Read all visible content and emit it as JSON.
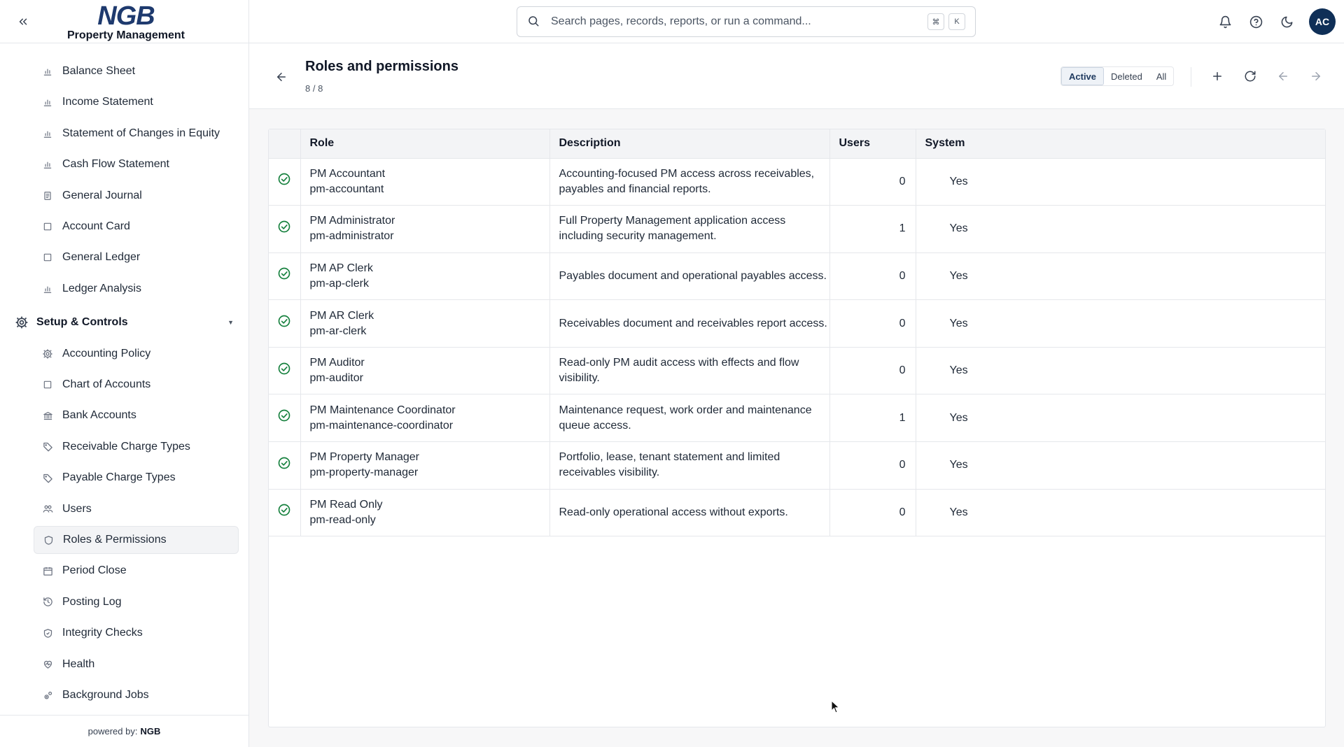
{
  "brand": {
    "logo": "NGB",
    "name": "Property Management"
  },
  "sidebar": {
    "items_top": [
      {
        "label": "Balance Sheet",
        "icon": "bar-chart-icon"
      },
      {
        "label": "Income Statement",
        "icon": "bar-chart-icon"
      },
      {
        "label": "Statement of Changes in Equity",
        "icon": "bar-chart-icon"
      },
      {
        "label": "Cash Flow Statement",
        "icon": "bar-chart-icon"
      },
      {
        "label": "General Journal",
        "icon": "document-icon"
      },
      {
        "label": "Account Card",
        "icon": "square-icon"
      },
      {
        "label": "General Ledger",
        "icon": "square-icon"
      },
      {
        "label": "Ledger Analysis",
        "icon": "bar-chart-icon"
      }
    ],
    "section": {
      "label": "Setup & Controls",
      "icon": "gear-icon"
    },
    "items_setup": [
      {
        "label": "Accounting Policy",
        "icon": "gear-icon"
      },
      {
        "label": "Chart of Accounts",
        "icon": "square-icon"
      },
      {
        "label": "Bank Accounts",
        "icon": "bank-icon"
      },
      {
        "label": "Receivable Charge Types",
        "icon": "tag-icon"
      },
      {
        "label": "Payable Charge Types",
        "icon": "tag-icon"
      },
      {
        "label": "Users",
        "icon": "users-icon"
      },
      {
        "label": "Roles & Permissions",
        "icon": "shield-icon",
        "active": true
      },
      {
        "label": "Period Close",
        "icon": "calendar-icon"
      },
      {
        "label": "Posting Log",
        "icon": "history-icon"
      },
      {
        "label": "Integrity Checks",
        "icon": "shield-check-icon"
      },
      {
        "label": "Health",
        "icon": "heart-pulse-icon"
      },
      {
        "label": "Background Jobs",
        "icon": "cogs-icon"
      }
    ],
    "footer": {
      "prefix": "powered by:",
      "brand": "NGB"
    }
  },
  "topbar": {
    "search_placeholder": "Search pages, records, reports, or run a command...",
    "kbd": [
      "⌘",
      "K"
    ],
    "avatar": "AC"
  },
  "page": {
    "title": "Roles and permissions",
    "count": "8 / 8",
    "filters": [
      "Active",
      "Deleted",
      "All"
    ],
    "active_filter": "Active"
  },
  "table": {
    "columns": [
      "Role",
      "Description",
      "Users",
      "System"
    ],
    "rows": [
      {
        "name": "PM Accountant",
        "code": "pm-accountant",
        "description": "Accounting-focused PM access across receivables, payables and financial reports.",
        "users": "0",
        "system": "Yes"
      },
      {
        "name": "PM Administrator",
        "code": "pm-administrator",
        "description": "Full Property Management application access including security management.",
        "users": "1",
        "system": "Yes"
      },
      {
        "name": "PM AP Clerk",
        "code": "pm-ap-clerk",
        "description": "Payables document and operational payables access.",
        "users": "0",
        "system": "Yes"
      },
      {
        "name": "PM AR Clerk",
        "code": "pm-ar-clerk",
        "description": "Receivables document and receivables report access.",
        "users": "0",
        "system": "Yes"
      },
      {
        "name": "PM Auditor",
        "code": "pm-auditor",
        "description": "Read-only PM audit access with effects and flow visibility.",
        "users": "0",
        "system": "Yes"
      },
      {
        "name": "PM Maintenance Coordinator",
        "code": "pm-maintenance-coordinator",
        "description": "Maintenance request, work order and maintenance queue access.",
        "users": "1",
        "system": "Yes"
      },
      {
        "name": "PM Property Manager",
        "code": "pm-property-manager",
        "description": "Portfolio, lease, tenant statement and limited receivables visibility.",
        "users": "0",
        "system": "Yes"
      },
      {
        "name": "PM Read Only",
        "code": "pm-read-only",
        "description": "Read-only operational access without exports.",
        "users": "0",
        "system": "Yes"
      }
    ]
  },
  "colors": {
    "accent": "#1e3a6e",
    "success": "#15803d",
    "avatar_bg": "#0f2f57"
  }
}
